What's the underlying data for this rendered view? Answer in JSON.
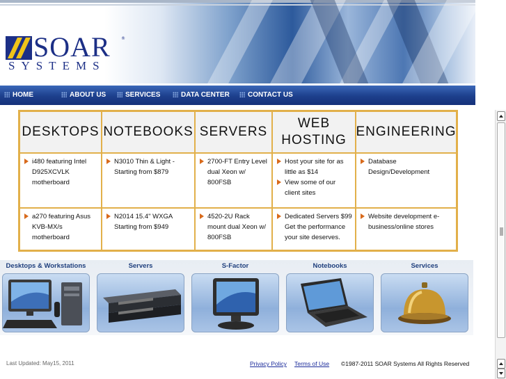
{
  "brand": {
    "name": "SOAR",
    "sub": "SYSTEMS"
  },
  "nav": [
    {
      "label": "HOME"
    },
    {
      "label": "ABOUT US"
    },
    {
      "label": "SERVICES"
    },
    {
      "label": "DATA CENTER"
    },
    {
      "label": "CONTACT US"
    }
  ],
  "categories": [
    {
      "title": "DESKTOPS",
      "row1": [
        "i480 featuring Intel D925XCVLK motherboard"
      ],
      "row2": [
        "a270 featuring Asus KVB-MX/s motherboard"
      ]
    },
    {
      "title": "NOTEBOOKS",
      "row1": [
        "N3010 Thin & Light - Starting from $879"
      ],
      "row2": [
        "N2014 15.4\" WXGA Starting from $949"
      ]
    },
    {
      "title": "SERVERS",
      "row1": [
        "2700-FT Entry Level dual Xeon w/ 800FSB"
      ],
      "row2": [
        "4520-2U Rack mount dual Xeon w/ 800FSB"
      ]
    },
    {
      "title": "WEB HOSTING",
      "row1": [
        "Host your site for as little as $14",
        "View some of our client sites"
      ],
      "row2": [
        "Dedicated Servers $99 Get the performance your site deserves."
      ]
    },
    {
      "title": "ENGINEERING",
      "row1": [
        "Database Design/Development"
      ],
      "row2": [
        "Website development e-business/online stores"
      ]
    }
  ],
  "products": [
    {
      "label": "Desktops & Workstations",
      "icon": "desktop-workstation-image"
    },
    {
      "label": "Servers",
      "icon": "rack-server-image"
    },
    {
      "label": "S-Factor",
      "icon": "lcd-monitor-image"
    },
    {
      "label": "Notebooks",
      "icon": "notebook-image"
    },
    {
      "label": "Services",
      "icon": "service-bell-image"
    }
  ],
  "footer": {
    "updated": "Last Updated: May15, 2011",
    "privacy": "Privacy Policy",
    "terms": "Terms of Use",
    "copyright": "©1987-2011 SOAR Systems All Rights Reserved"
  },
  "colors": {
    "nav": "#1d3f8c",
    "grid_border": "#e2b04a",
    "bullet": "#d86a1c",
    "brand": "#1c2f86",
    "logo_accent": "#f0c419"
  }
}
